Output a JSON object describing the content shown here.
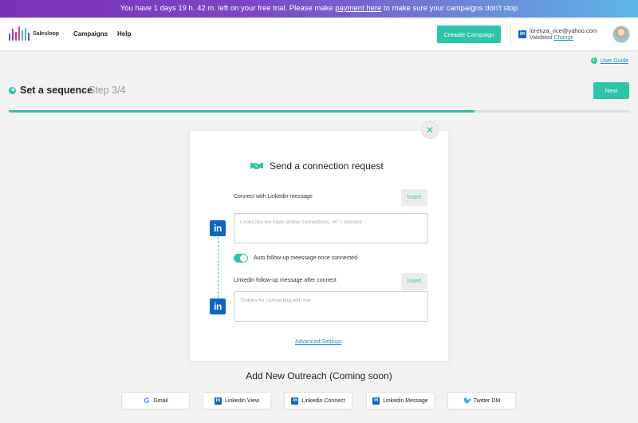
{
  "banner": {
    "text_before": "You have 1 days 19 h. 42 m. left on your free trial. Please make ",
    "link": "payment here",
    "text_after": " to make sure your campaigns don't stop"
  },
  "header": {
    "logo": "Salesloop",
    "nav": [
      "Campaigns",
      "Help"
    ],
    "create_button": "Creaate Campaign",
    "account": {
      "email": "lorenza_rice@yahoo.com",
      "status": "Validated",
      "change_link": "Change"
    }
  },
  "user_guide": "User Guide",
  "step": {
    "title": "Set a sequence",
    "subtitle": "Step 3/4",
    "next_button": "Next",
    "progress": 0.75
  },
  "card": {
    "title": "Send a connection request",
    "close_icon": "close-icon",
    "connect_label": "Connect with Linkedin message",
    "insert_label": "Insert",
    "connect_placeholder": "Looks like we have similar connections, let`s connect",
    "toggle_label": "Auto follow-up meessage once connected",
    "toggle_on": true,
    "followup_label": "Linkedin follow-up message after connect",
    "followup_placeholder": "Thanks for connecting with me",
    "advanced_link": "Advanced Settings",
    "linkedin_badge": "in"
  },
  "outreach": {
    "title": "Add New Outreach (Coming soon)",
    "buttons": [
      {
        "label": "Gmail",
        "icon": "google-icon"
      },
      {
        "label": "Linkedin View",
        "icon": "linkedin-icon"
      },
      {
        "label": "Linkedin Connect",
        "icon": "linkedin-icon"
      },
      {
        "label": "Linkedin Message",
        "icon": "linkedin-icon"
      },
      {
        "label": "Twitter DM",
        "icon": "twitter-icon"
      }
    ]
  },
  "colors": {
    "accent": "#2ec4a9",
    "linkedin": "#0a66c2",
    "link": "#2a8fd0"
  }
}
